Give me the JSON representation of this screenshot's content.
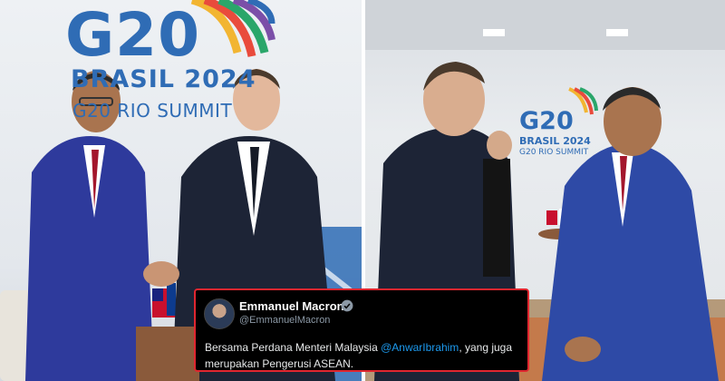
{
  "left_photo": {
    "backdrop": {
      "logo_g20": "G20",
      "logo_brasil": "BRASIL 2024",
      "logo_summit": "G20 RIO SUMMIT"
    }
  },
  "right_photo": {
    "backdrop": {
      "logo_g20": "G20",
      "logo_brasil": "BRASIL 2024",
      "logo_summit": "G20 RIO SUMMIT"
    }
  },
  "tweet": {
    "author_name": "Emmanuel Macron",
    "author_handle": "@EmmanuelMacron",
    "verified": true,
    "text_before": "Bersama Perdana Menteri Malaysia ",
    "mention": "@AnwarIbrahim",
    "text_after": ", yang juga merupakan Pengerusi ASEAN.",
    "border_color": "#e0262f",
    "mention_color": "#1d9bf0"
  },
  "colors": {
    "logo_blue": "#2f6cb5"
  }
}
